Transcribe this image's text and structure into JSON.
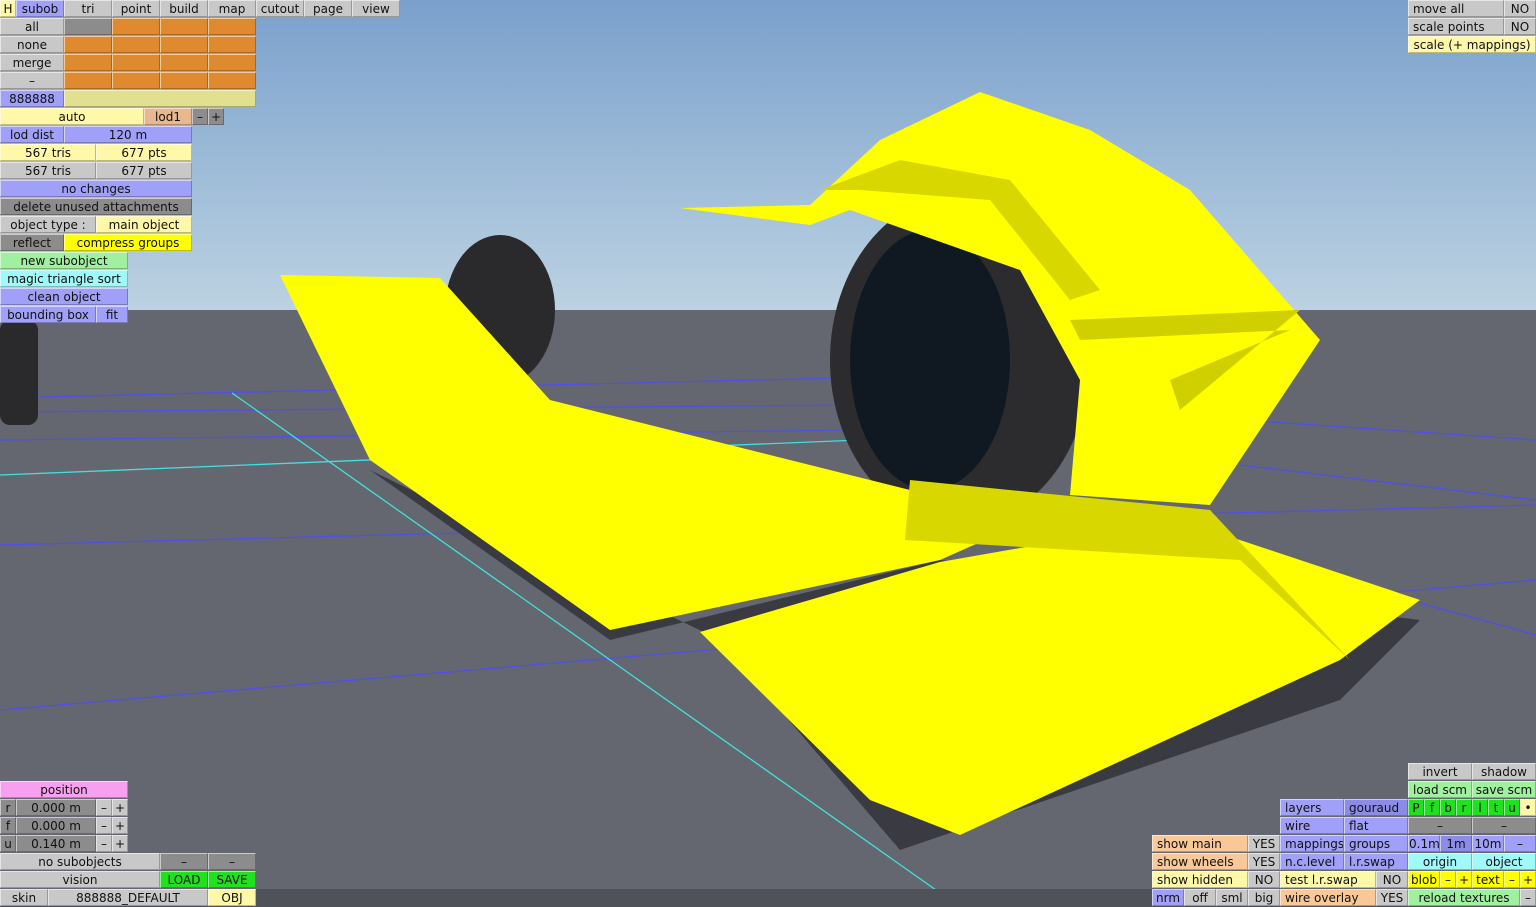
{
  "colors": {
    "gray": "#c8c8c8",
    "dark": "#8c8c8c",
    "blue": "#a0a0f8",
    "blue2": "#8c8ce8",
    "lyellow": "#fff8a8",
    "yellow": "#ffff00",
    "orange": "#e08a30",
    "khaki": "#e0e090",
    "peach": "#f8c898",
    "lod": "#e8b890",
    "lgreen": "#a0f0a0",
    "cyan": "#a0f8f8",
    "pink": "#f8a0f0",
    "green": "#20e020"
  },
  "tabs": {
    "h": "H",
    "subob": "subob",
    "tri": "tri",
    "point": "point",
    "build": "build",
    "map": "map",
    "cutout": "cutout",
    "page": "page",
    "view": "view"
  },
  "left": {
    "all": "all",
    "none": "none",
    "merge": "merge",
    "dash": "–",
    "color_code": "888888",
    "auto": "auto",
    "lod": "lod1",
    "lod_minus": "–",
    "lod_plus": "+",
    "lod_dist": "lod dist",
    "lod_dist_value": "120 m",
    "tris1": "567 tris",
    "pts1": "677 pts",
    "tris2": "567 tris",
    "pts2": "677 pts",
    "no_changes": "no changes",
    "delete_unused": "delete unused attachments",
    "object_type_label": "object type :",
    "object_type": "main object",
    "reflect": "reflect",
    "compress_groups": "compress groups",
    "new_subobject": "new subobject",
    "magic_sort": "magic triangle sort",
    "clean_object": "clean object",
    "bounding_box": "bounding box",
    "fit": "fit"
  },
  "top_right": {
    "move_all": "move all",
    "move_all_value": "NO",
    "scale_points": "scale points",
    "scale_points_value": "NO",
    "scale_mappings": "scale (+ mappings)"
  },
  "position": {
    "title": "position",
    "r_label": "r",
    "r": "0.000 m",
    "f_label": "f",
    "f": "0.000 m",
    "u_label": "u",
    "u": "0.140 m",
    "minus": "–",
    "plus": "+"
  },
  "bottom_left": {
    "no_subobjects": "no subobjects",
    "dash": "–",
    "vision": "vision",
    "load": "LOAD",
    "save": "SAVE",
    "skin": "skin",
    "skin_value": "888888_DEFAULT",
    "obj": "OBJ"
  },
  "bottom_right": {
    "invert": "invert",
    "shadow": "shadow",
    "load_scm": "load scm",
    "save_scm": "save scm",
    "layers": "layers",
    "gouraud": "gouraud",
    "views": [
      "P",
      "f",
      "b",
      "r",
      "l",
      "t",
      "u"
    ],
    "dot": "•",
    "wire": "wire",
    "flat": "flat",
    "dash": "–",
    "show_main": "show main",
    "show_main_value": "YES",
    "mappings": "mappings",
    "groups": "groups",
    "g01": "0.1m",
    "g1": "1m",
    "g10": "10m",
    "show_wheels": "show wheels",
    "show_wheels_value": "YES",
    "nc_level": "n.c.level",
    "lr_swap": "l.r.swap",
    "origin": "origin",
    "object": "object",
    "show_hidden": "show hidden",
    "show_hidden_value": "NO",
    "test_lr_swap": "test l.r.swap",
    "test_lr_swap_value": "NO",
    "blob": "blob",
    "text": "text",
    "minus": "–",
    "plus": "+",
    "nrm": "nrm",
    "off": "off",
    "sml": "sml",
    "big": "big",
    "wire_overlay": "wire overlay",
    "wire_overlay_value": "YES",
    "reload_textures": "reload textures"
  }
}
